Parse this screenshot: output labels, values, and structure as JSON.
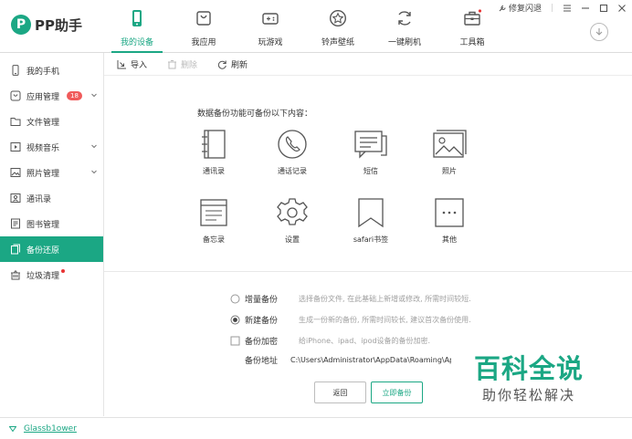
{
  "app": {
    "logo_mark": "P",
    "logo_text": "PP助手"
  },
  "nav": {
    "tabs": [
      {
        "label": "我的设备",
        "icon": "phone-icon",
        "active": true
      },
      {
        "label": "我应用",
        "icon": "bag-icon"
      },
      {
        "label": "玩游戏",
        "icon": "gamepad-icon"
      },
      {
        "label": "铃声壁纸",
        "icon": "star-icon"
      },
      {
        "label": "一键刷机",
        "icon": "refresh-icon"
      },
      {
        "label": "工具箱",
        "icon": "toolbox-icon"
      }
    ]
  },
  "window": {
    "repair_label": "修复闪退",
    "download_icon": "download-icon"
  },
  "sidebar": {
    "items": [
      {
        "label": "我的手机",
        "icon": "phone-icon"
      },
      {
        "label": "应用管理",
        "icon": "app-icon",
        "badge": "18"
      },
      {
        "label": "文件管理",
        "icon": "folder-icon"
      },
      {
        "label": "视频音乐",
        "icon": "video-icon"
      },
      {
        "label": "照片管理",
        "icon": "photo-icon"
      },
      {
        "label": "通讯录",
        "icon": "contact-icon"
      },
      {
        "label": "图书管理",
        "icon": "book-icon"
      },
      {
        "label": "备份还原",
        "icon": "backup-icon",
        "active": true
      },
      {
        "label": "垃圾清理",
        "icon": "trash-icon"
      }
    ]
  },
  "toolbar": {
    "import_label": "导入",
    "delete_label": "删除",
    "refresh_label": "刷新"
  },
  "backup": {
    "prompt": "数据备份功能可备份以下内容：",
    "items": [
      {
        "label": "通讯录",
        "icon": "contacts-icon"
      },
      {
        "label": "通话记录",
        "icon": "call-log-icon"
      },
      {
        "label": "短信",
        "icon": "sms-icon"
      },
      {
        "label": "照片",
        "icon": "photos-icon"
      },
      {
        "label": "备忘录",
        "icon": "memo-icon"
      },
      {
        "label": "设置",
        "icon": "settings-icon"
      },
      {
        "label": "safari书签",
        "icon": "bookmark-icon"
      },
      {
        "label": "其他",
        "icon": "other-icon"
      }
    ]
  },
  "options": {
    "incremental": {
      "label": "增量备份",
      "desc": "选择备份文件, 在此基础上新增或修改, 所需时间较短."
    },
    "new_backup": {
      "label": "新建备份",
      "desc": "生成一份新的备份, 所需时间较长, 建议首次备份使用."
    },
    "encrypt": {
      "label": "备份加密",
      "desc": "给iPhone、ipad、ipod设备的备份加密."
    },
    "path": {
      "label": "备份地址",
      "value": "C:\\Users\\Administrator\\AppData\\Roaming\\Apple Computer\\MobileSync\\Backup"
    }
  },
  "buttons": {
    "back": "返回",
    "start": "立即备份"
  },
  "watermark": {
    "line1": "百科全说",
    "line2": "助你轻松解决"
  },
  "status": {
    "device_name": "Glassb1ower"
  },
  "colors": {
    "accent": "#1ba784",
    "badge": "#f05a5a"
  }
}
